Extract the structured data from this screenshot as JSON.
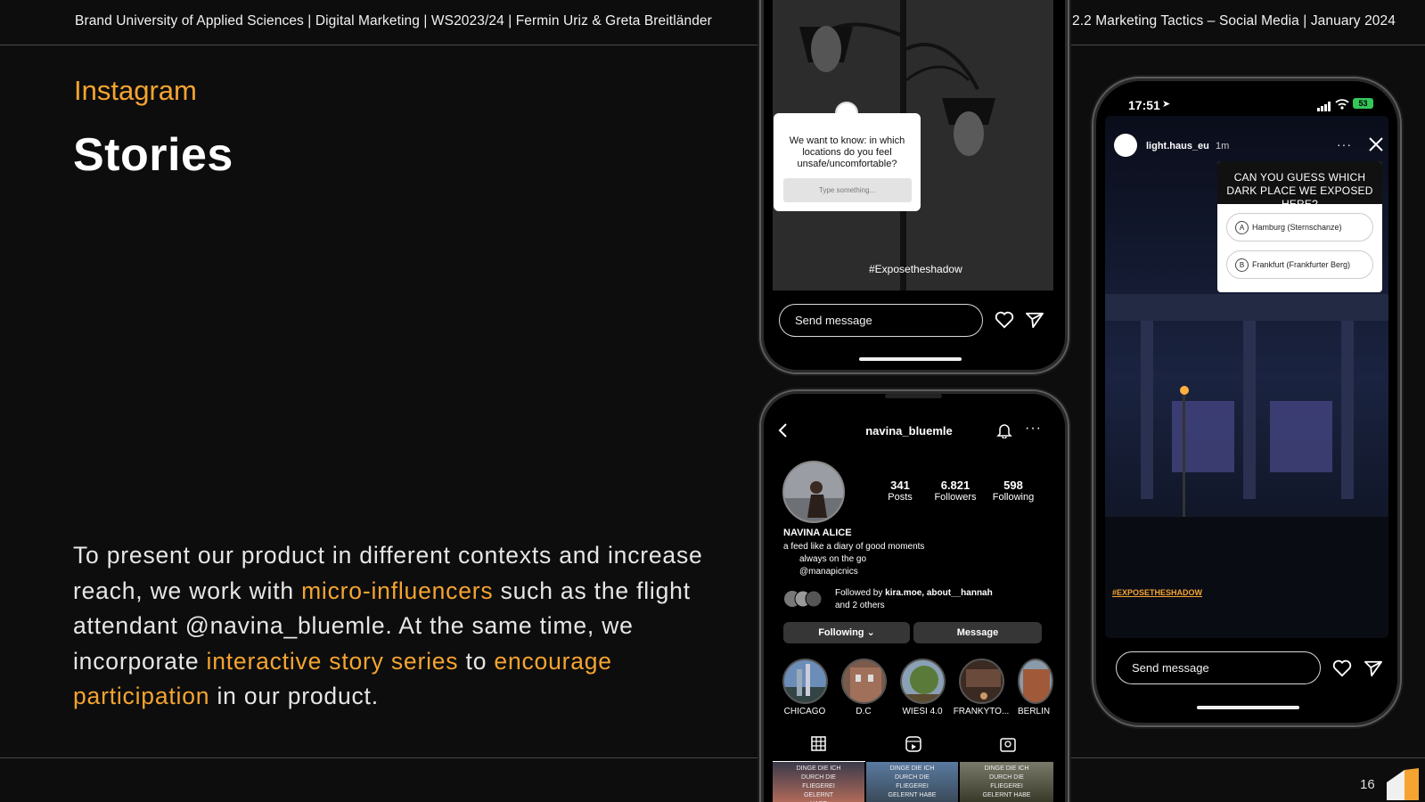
{
  "header": {
    "left": "Brand University of Applied Sciences | Digital Marketing | WS2023/24 | Fermin Uriz & Greta Breitländer",
    "right": "2.2 Marketing Tactics – Social Media | January 2024"
  },
  "slide": {
    "eyebrow": "Instagram",
    "title": "Stories",
    "body": {
      "p1": "To present our product in different contexts and increase reach, we work with ",
      "h1": "micro-influencers",
      "p2": " such as the flight attendant @navina_bluemle. At the same time, we incorporate ",
      "h2": "interactive story series",
      "p3": " to ",
      "h3": "encourage participation",
      "p4": " in our product."
    },
    "page_number": "16"
  },
  "phone_top": {
    "question": "We want to know: in which locations do you feel unsafe/uncomfortable?",
    "input_placeholder": "Type something...",
    "hashtag": "#Exposetheshadow",
    "send_placeholder": "Send message"
  },
  "phone_profile": {
    "username": "navina_bluemle",
    "stats": [
      {
        "value": "341",
        "label": "Posts"
      },
      {
        "value": "6.821",
        "label": "Followers"
      },
      {
        "value": "598",
        "label": "Following"
      }
    ],
    "display_name": "NAVINA ALICE",
    "bio": [
      "a feed like a diary of good moments",
      "always on the go",
      "@manapicnics"
    ],
    "followed_by_prefix": "Followed by ",
    "followed_by_names": "kira.moe, about__hannah",
    "followed_by_suffix": "and 2 others",
    "following_btn": "Following",
    "message_btn": "Message",
    "highlights": [
      "CHICAGO",
      "D.C",
      "WIESI 4.0",
      "FRANKYTO...",
      "BERLIN"
    ],
    "post_caption": "DINGE DIE ICH DURCH DIE FLIEGEREI GELERNT HABE"
  },
  "phone_story": {
    "time": "17:51",
    "battery": "53",
    "account": "light.haus_eu",
    "age": "1m",
    "quiz_question": "CAN YOU GUESS WHICH DARK PLACE WE EXPOSED HERE?",
    "options": [
      {
        "letter": "A",
        "text": "Hamburg (Sternschanze)"
      },
      {
        "letter": "B",
        "text": "Frankfurt (Frankfurter Berg)"
      }
    ],
    "hashtag": "#EXPOSETHESHADOW",
    "send_placeholder": "Send message"
  },
  "colors": {
    "accent": "#f5a431",
    "background": "#0d0d0d"
  }
}
